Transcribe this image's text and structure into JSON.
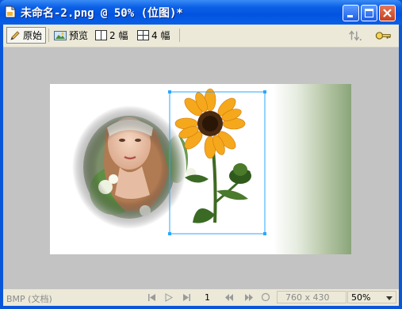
{
  "window": {
    "title": "未命名-2.png @  50% (位图)*"
  },
  "toolbar": {
    "original_label": "原始",
    "preview_label": "预览",
    "two_up_label": "2 幅",
    "four_up_label": "4 幅"
  },
  "status": {
    "doc_type": "BMP (文档)",
    "page_number": "1",
    "dimensions": "760 x 430",
    "zoom": "50%"
  },
  "colors": {
    "titlebar_blue": "#0a56d8",
    "selection_blue": "#2aa7ff",
    "canvas_gray": "#c3c3c3"
  },
  "icons": {
    "document": "document-icon",
    "original": "pencil-icon",
    "preview": "image-preview-icon",
    "two_up": "split-2-icon",
    "four_up": "split-4-icon",
    "export": "export-arrows-icon",
    "zoom": "key-magnifier-icon"
  }
}
